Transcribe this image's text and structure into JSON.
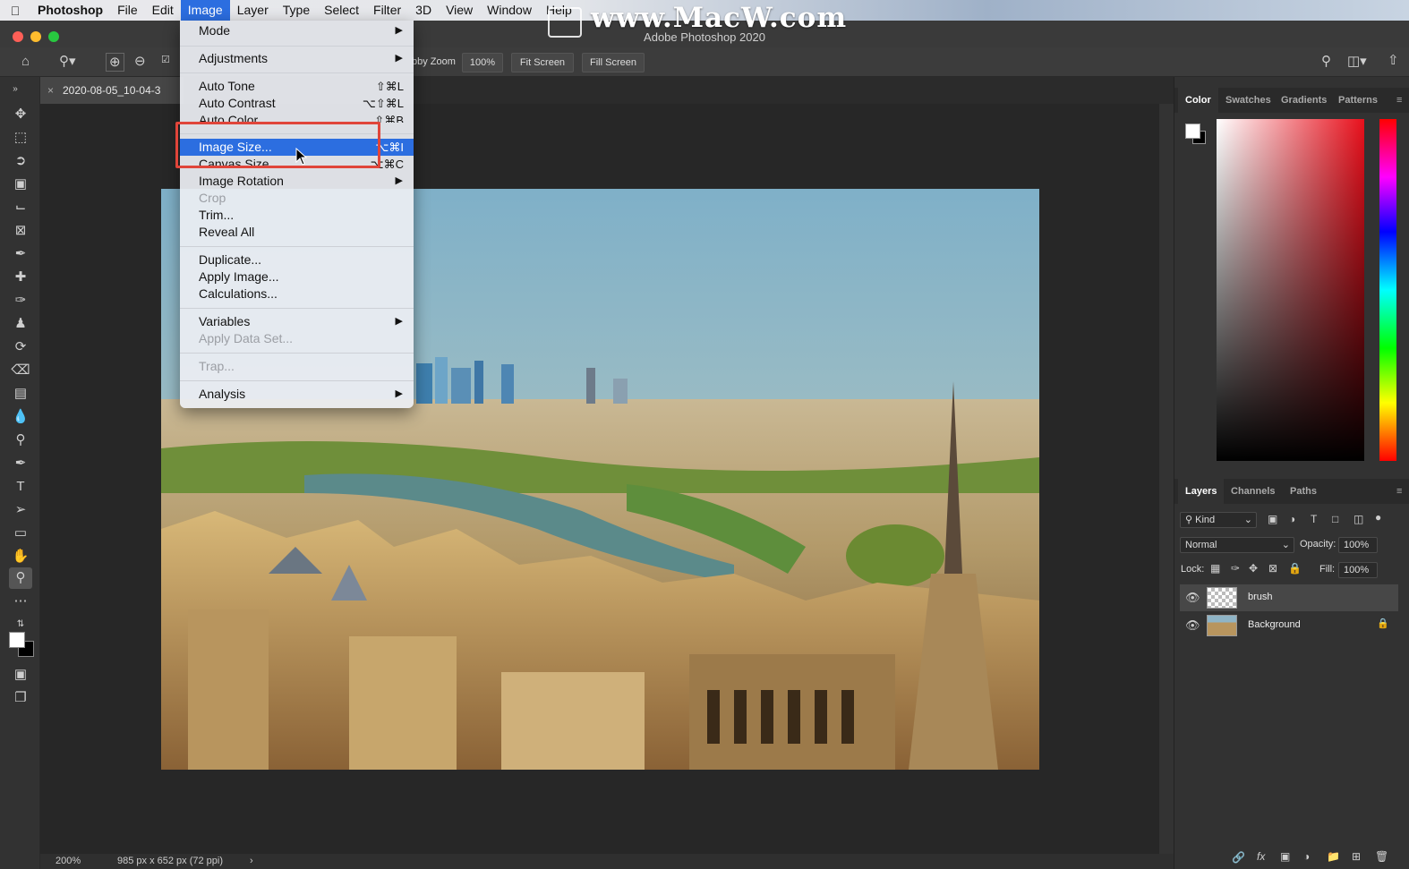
{
  "menubar": {
    "items": [
      "Photoshop",
      "File",
      "Edit",
      "Image",
      "Layer",
      "Type",
      "Select",
      "Filter",
      "3D",
      "View",
      "Window",
      "Help"
    ],
    "active": "Image"
  },
  "watermark": "www.MacW.com",
  "window": {
    "title": "Adobe Photoshop 2020"
  },
  "options": {
    "scrubby_zoom": "bby Zoom",
    "zoom_value": "100%",
    "fit_screen": "Fit Screen",
    "fill_screen": "Fill Screen"
  },
  "document": {
    "tab": "2020-08-05_10-04-3",
    "status_zoom": "200%",
    "status_info": "985 px x 652 px (72 ppi)"
  },
  "image_menu": {
    "mode": "Mode",
    "adjustments": "Adjustments",
    "auto_tone": "Auto Tone",
    "auto_tone_sc": "⇧⌘L",
    "auto_contrast": "Auto Contrast",
    "auto_contrast_sc": "⌥⇧⌘L",
    "auto_color": "Auto Color",
    "auto_color_sc": "⇧⌘B",
    "image_size": "Image Size...",
    "image_size_sc": "⌥⌘I",
    "canvas_size": "Canvas Size...",
    "canvas_size_sc": "⌥⌘C",
    "image_rotation": "Image Rotation",
    "crop": "Crop",
    "trim": "Trim...",
    "reveal_all": "Reveal All",
    "duplicate": "Duplicate...",
    "apply_image": "Apply Image...",
    "calculations": "Calculations...",
    "variables": "Variables",
    "apply_data_set": "Apply Data Set...",
    "trap": "Trap...",
    "analysis": "Analysis"
  },
  "color_panel": {
    "tabs": [
      "Color",
      "Swatches",
      "Gradients",
      "Patterns"
    ],
    "active_tab": "Color",
    "hue_color": "#e8101c"
  },
  "layers_panel": {
    "tabs": [
      "Layers",
      "Channels",
      "Paths"
    ],
    "kind": "Kind",
    "blend_mode": "Normal",
    "opacity_label": "Opacity:",
    "opacity": "100%",
    "lock_label": "Lock:",
    "fill_label": "Fill:",
    "fill": "100%",
    "layers": [
      "brush",
      "Background"
    ]
  }
}
